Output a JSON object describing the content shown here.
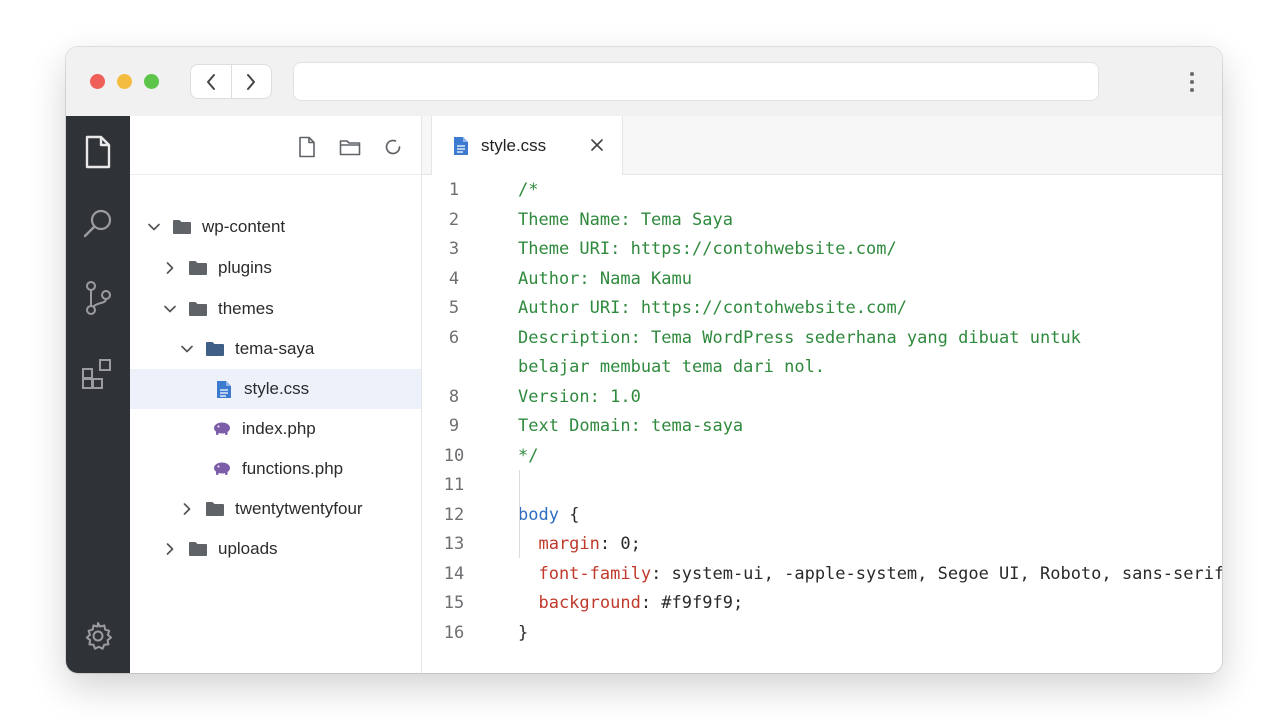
{
  "editor": {
    "tab": {
      "label": "style.css"
    },
    "lines": [
      {
        "n": "1",
        "parts": [
          {
            "t": "/*",
            "c": "comment"
          }
        ]
      },
      {
        "n": "2",
        "parts": [
          {
            "t": "Theme Name: Tema Saya",
            "c": "comment"
          }
        ]
      },
      {
        "n": "3",
        "parts": [
          {
            "t": "Theme URI: https://contohwebsite.com/",
            "c": "comment"
          }
        ]
      },
      {
        "n": "4",
        "parts": [
          {
            "t": "Author: Nama Kamu",
            "c": "comment"
          }
        ]
      },
      {
        "n": "5",
        "parts": [
          {
            "t": "Author URI: https://contohwebsite.com/",
            "c": "comment"
          }
        ]
      },
      {
        "n": "6",
        "parts": [
          {
            "t": "Description: Tema WordPress sederhana yang dibuat untuk",
            "c": "comment"
          }
        ]
      },
      {
        "n": "",
        "parts": [
          {
            "t": "belajar membuat tema dari nol.",
            "c": "comment"
          }
        ]
      },
      {
        "n": "8",
        "parts": [
          {
            "t": "Version: 1.0",
            "c": "comment"
          }
        ]
      },
      {
        "n": "9",
        "parts": [
          {
            "t": "Text Domain: tema-saya",
            "c": "comment"
          }
        ]
      },
      {
        "n": "10",
        "parts": [
          {
            "t": "*/",
            "c": "comment"
          }
        ]
      },
      {
        "n": "11",
        "parts": []
      },
      {
        "n": "12",
        "parts": [
          {
            "t": "body",
            "c": "sel"
          },
          {
            "t": " {",
            "c": "punc"
          }
        ]
      },
      {
        "n": "13",
        "parts": [
          {
            "t": "  margin",
            "c": "prop"
          },
          {
            "t": ": 0;",
            "c": "val"
          }
        ]
      },
      {
        "n": "14",
        "parts": [
          {
            "t": "  font-family",
            "c": "prop"
          },
          {
            "t": ": system-ui, -apple-system, Segoe UI, Roboto, sans-serif;",
            "c": "val"
          }
        ]
      },
      {
        "n": "15",
        "parts": [
          {
            "t": "  background",
            "c": "prop"
          },
          {
            "t": ": #f9f9f9;",
            "c": "val"
          }
        ]
      },
      {
        "n": "16",
        "parts": [
          {
            "t": "}",
            "c": "punc"
          }
        ]
      }
    ]
  },
  "explorer": {
    "items": [
      {
        "label": "wp-content",
        "expanded": true
      },
      {
        "label": "plugins",
        "expanded": false
      },
      {
        "label": "themes",
        "expanded": true
      },
      {
        "label": "tema-saya",
        "expanded": true
      },
      {
        "label": "style.css",
        "selected": true
      },
      {
        "label": "index.php"
      },
      {
        "label": "functions.php"
      },
      {
        "label": "twentytwentyfour",
        "expanded": false
      },
      {
        "label": "uploads",
        "expanded": false
      }
    ]
  },
  "colors": {
    "comment": "#2f8a3e",
    "selector": "#2e6cc1",
    "property": "#c0392b",
    "folder": "#5f6368",
    "folder_open": "#3f5f86",
    "css_file": "#3d7bd0",
    "php_file": "#7b5ea7"
  }
}
